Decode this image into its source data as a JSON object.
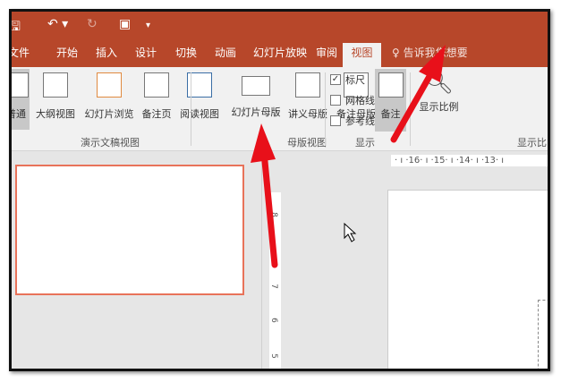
{
  "tabs": [
    "文件",
    "开始",
    "插入",
    "设计",
    "切换",
    "动画",
    "幻灯片放映",
    "审阅",
    "视图"
  ],
  "active_tab": "视图",
  "tell_me": "告诉我您想要",
  "presentation_views": {
    "group": "演示文稿视图",
    "buttons": [
      "普通",
      "大纲视图",
      "幻灯片浏览",
      "备注页",
      "阅读视图"
    ]
  },
  "master_views": {
    "group": "母版视图",
    "buttons": [
      "幻灯片母版",
      "讲义母版",
      "备注母版"
    ]
  },
  "show": {
    "group": "显示",
    "checkboxes": [
      {
        "label": "标尺",
        "checked": true
      },
      {
        "label": "网格线",
        "checked": false
      },
      {
        "label": "参考线",
        "checked": false
      }
    ],
    "notes": "备注"
  },
  "zoom": {
    "group": "显示比",
    "button": "显示比例"
  },
  "hruler": "· ı ·16· ı ·15· ı ·14· ı ·13· ı",
  "vruler": [
    "8",
    "7",
    "6",
    "5"
  ],
  "colors": {
    "accent": "#b7472a",
    "arrow": "#e8101a"
  }
}
